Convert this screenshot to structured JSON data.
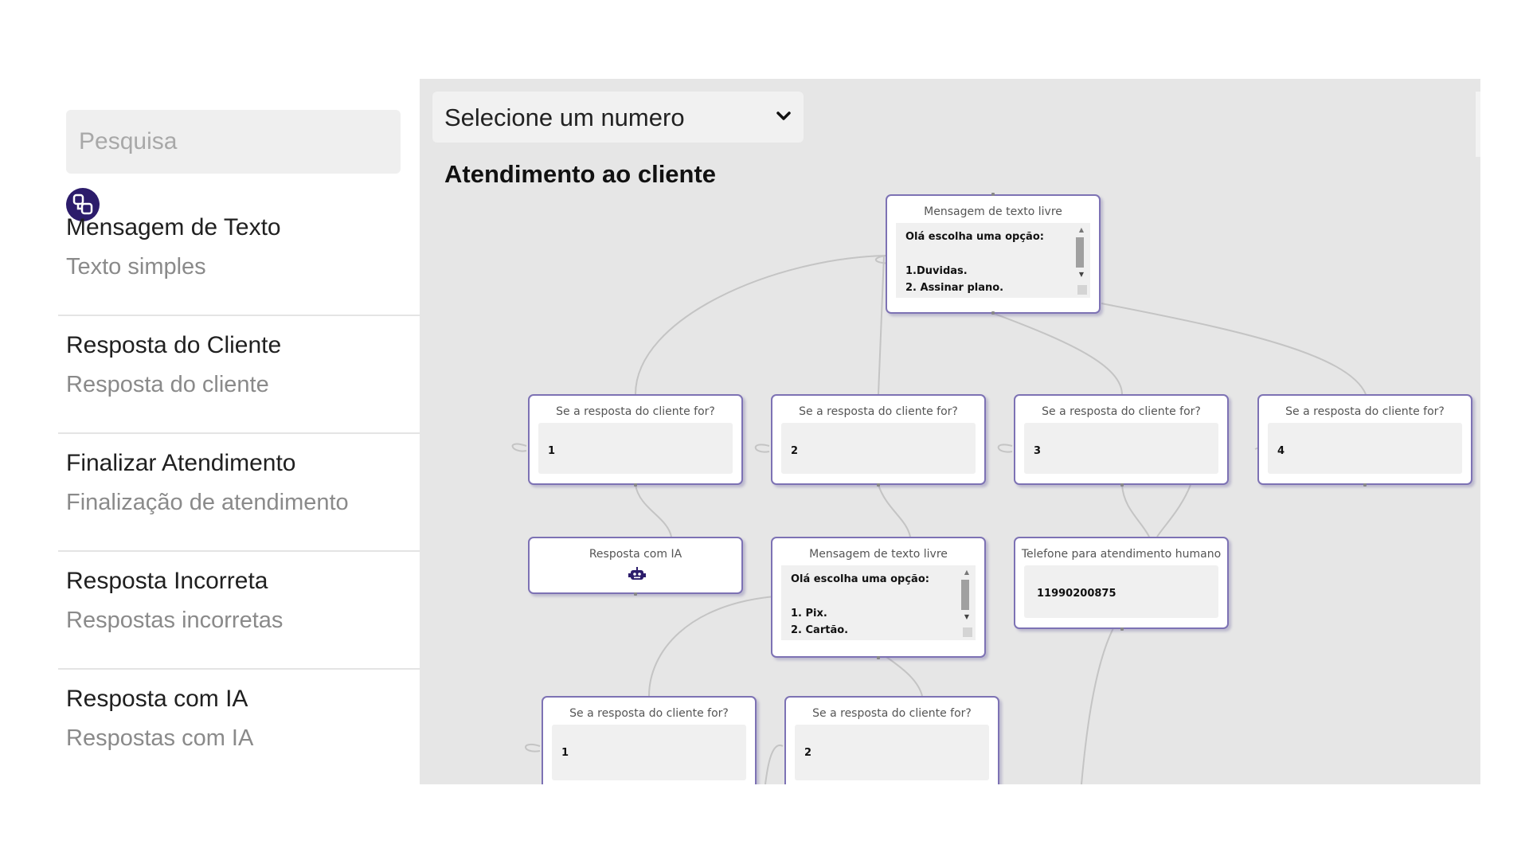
{
  "search": {
    "placeholder": "Pesquisa"
  },
  "icons": {
    "flow": "flow-diagram-icon",
    "select_chevron": "chevron-down-icon",
    "robot": "robot-icon"
  },
  "colors": {
    "accent": "#2c1c6b",
    "node_border": "#7d72b4",
    "edge": "#c4c4c4"
  },
  "sidebar": {
    "items": [
      {
        "title": "Mensagem de Texto",
        "subtitle": "Texto simples"
      },
      {
        "title": "Resposta do Cliente",
        "subtitle": "Resposta do cliente"
      },
      {
        "title": "Finalizar Atendimento",
        "subtitle": "Finalização de atendimento"
      },
      {
        "title": "Resposta Incorreta",
        "subtitle": "Respostas incorretas"
      },
      {
        "title": "Resposta com IA",
        "subtitle": "Respostas com IA"
      }
    ]
  },
  "header": {
    "select_label": "Selecione um numero",
    "flow_title": "Atendimento ao cliente"
  },
  "nodes": {
    "msg1": {
      "head": "Mensagem de texto livre",
      "lines": [
        "Olá escolha uma opção:",
        "",
        "1.Duvidas.",
        "2. Assinar plano."
      ]
    },
    "r1": {
      "head": "Se a resposta do cliente for?",
      "value": "1"
    },
    "r2": {
      "head": "Se a resposta do cliente for?",
      "value": "2"
    },
    "r3": {
      "head": "Se a resposta do cliente for?",
      "value": "3"
    },
    "r4": {
      "head": "Se a resposta do cliente for?",
      "value": "4"
    },
    "ia": {
      "head": "Resposta com IA"
    },
    "msg2": {
      "head": "Mensagem de texto livre",
      "lines": [
        "Olá escolha uma opção:",
        "",
        "1. Pix.",
        "2. Cartão."
      ]
    },
    "tel": {
      "head": "Telefone para atendimento humano",
      "value": "11990200875"
    },
    "r5": {
      "head": "Se a resposta do cliente for?",
      "value": "1"
    },
    "r6": {
      "head": "Se a resposta do cliente for?",
      "value": "2"
    }
  }
}
